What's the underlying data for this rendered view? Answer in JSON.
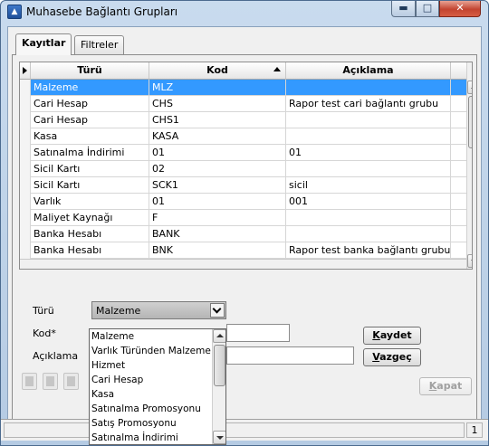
{
  "window": {
    "title": "Muhasebe Bağlantı Grupları",
    "app_icon": "app-logo-icon"
  },
  "tabs": [
    {
      "label": "Kayıtlar",
      "active": true
    },
    {
      "label": "Filtreler",
      "active": false
    }
  ],
  "grid": {
    "columns": [
      "Türü",
      "Kod",
      "Açıklama"
    ],
    "sorted_column": "Kod",
    "sort_direction": "ascending",
    "rows": [
      {
        "turu": "Malzeme",
        "kod": "MLZ",
        "aciklama": "",
        "selected": true
      },
      {
        "turu": "Cari Hesap",
        "kod": "CHS",
        "aciklama": "Rapor test cari bağlantı grubu"
      },
      {
        "turu": "Cari Hesap",
        "kod": "CHS1",
        "aciklama": ""
      },
      {
        "turu": "Kasa",
        "kod": "KASA",
        "aciklama": ""
      },
      {
        "turu": "Satınalma İndirimi",
        "kod": "01",
        "aciklama": "01"
      },
      {
        "turu": "Sicil Kartı",
        "kod": "02",
        "aciklama": ""
      },
      {
        "turu": "Sicil Kartı",
        "kod": "SCK1",
        "aciklama": "sicil"
      },
      {
        "turu": "Varlık",
        "kod": "01",
        "aciklama": "001"
      },
      {
        "turu": "Maliyet Kaynağı",
        "kod": "F",
        "aciklama": ""
      },
      {
        "turu": "Banka Hesabı",
        "kod": "BANK",
        "aciklama": ""
      },
      {
        "turu": "Banka Hesabı",
        "kod": "BNK",
        "aciklama": "Rapor test banka bağlantı grubu"
      }
    ]
  },
  "form": {
    "turu_label": "Türü",
    "turu_value": "Malzeme",
    "kod_label": "Kod*",
    "kod_value": "",
    "aciklama_label": "Açıklama",
    "aciklama_value": "",
    "save_label_first": "K",
    "save_label_rest": "aydet",
    "cancel_label_first": "V",
    "cancel_label_rest": "azgeç",
    "close_label_first": "K",
    "close_label_rest": "apat"
  },
  "dropdown": {
    "items": [
      "Malzeme",
      "Varlık Türünden Malzeme",
      "Hizmet",
      "Cari Hesap",
      "Kasa",
      "Satınalma Promosyonu",
      "Satış Promosyonu",
      "Satınalma İndirimi"
    ]
  },
  "toolbar": [
    "new-record-icon",
    "copy-record-icon",
    "delete-record-icon"
  ],
  "status": {
    "page": "1"
  },
  "colors": {
    "selection": "#3399ff",
    "close_button": "#c34430",
    "titlebar": "#c9dbee"
  }
}
